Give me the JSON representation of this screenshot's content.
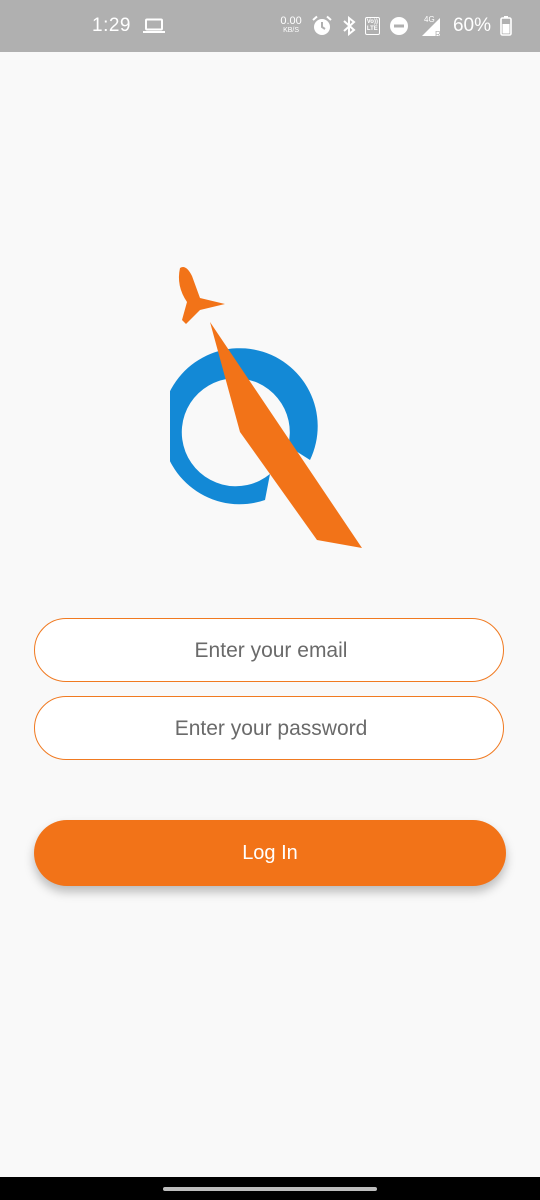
{
  "status_bar": {
    "time": "1:29",
    "net_speed_value": "0.00",
    "net_speed_unit": "KB/S",
    "volte_top": "Vo))",
    "volte_bottom": "LTE",
    "network_type": "4G",
    "roaming": "R",
    "battery_percent": "60%",
    "icons": [
      "laptop-icon",
      "alarm-icon",
      "bluetooth-icon",
      "volte-icon",
      "dnd-icon",
      "signal-icon",
      "battery-icon"
    ]
  },
  "login": {
    "email_placeholder": "Enter your email",
    "password_placeholder": "Enter your password",
    "login_label": "Log In"
  },
  "colors": {
    "accent_orange": "#f27318",
    "logo_blue": "#1389d6",
    "background": "#f9f9f9",
    "status_bar": "#b0b0b0"
  }
}
